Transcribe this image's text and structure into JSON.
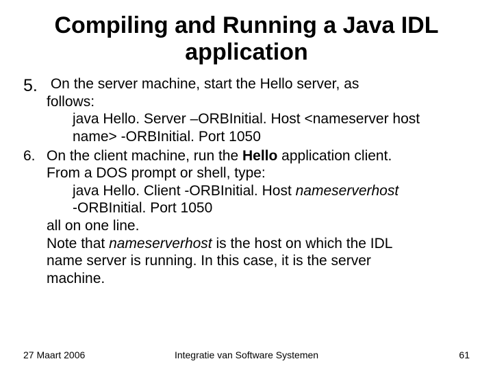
{
  "title": "Compiling and Running a Java IDL application",
  "items": {
    "i5": {
      "num": "5.",
      "line1a": "On the server machine, start the Hello server, as",
      "line1b": "follows:",
      "line2a": "java Hello. Server –ORBInitial. Host <nameserver host",
      "line2b": "name> -ORBInitial. Port 1050"
    },
    "i6": {
      "num": "6.",
      "line1a": "On the client machine, run the ",
      "hello": "Hello",
      "line1b": " application client.",
      "line1c": "From a DOS prompt or shell, type:",
      "line2a": "java Hello. Client -ORBInitial. Host ",
      "nsh1": "nameserverhost",
      "line2b": " -ORBInitial. Port 1050",
      "line3": "all on one line.",
      "line4a": "Note that ",
      "nsh2": "nameserverhost",
      "line4b": " is the host on which the IDL",
      "line4c": "name server is running. In this case, it is the server",
      "line4d": "machine."
    }
  },
  "footer": {
    "date": "27 Maart 2006",
    "center": "Integratie van Software Systemen",
    "page": "61"
  }
}
